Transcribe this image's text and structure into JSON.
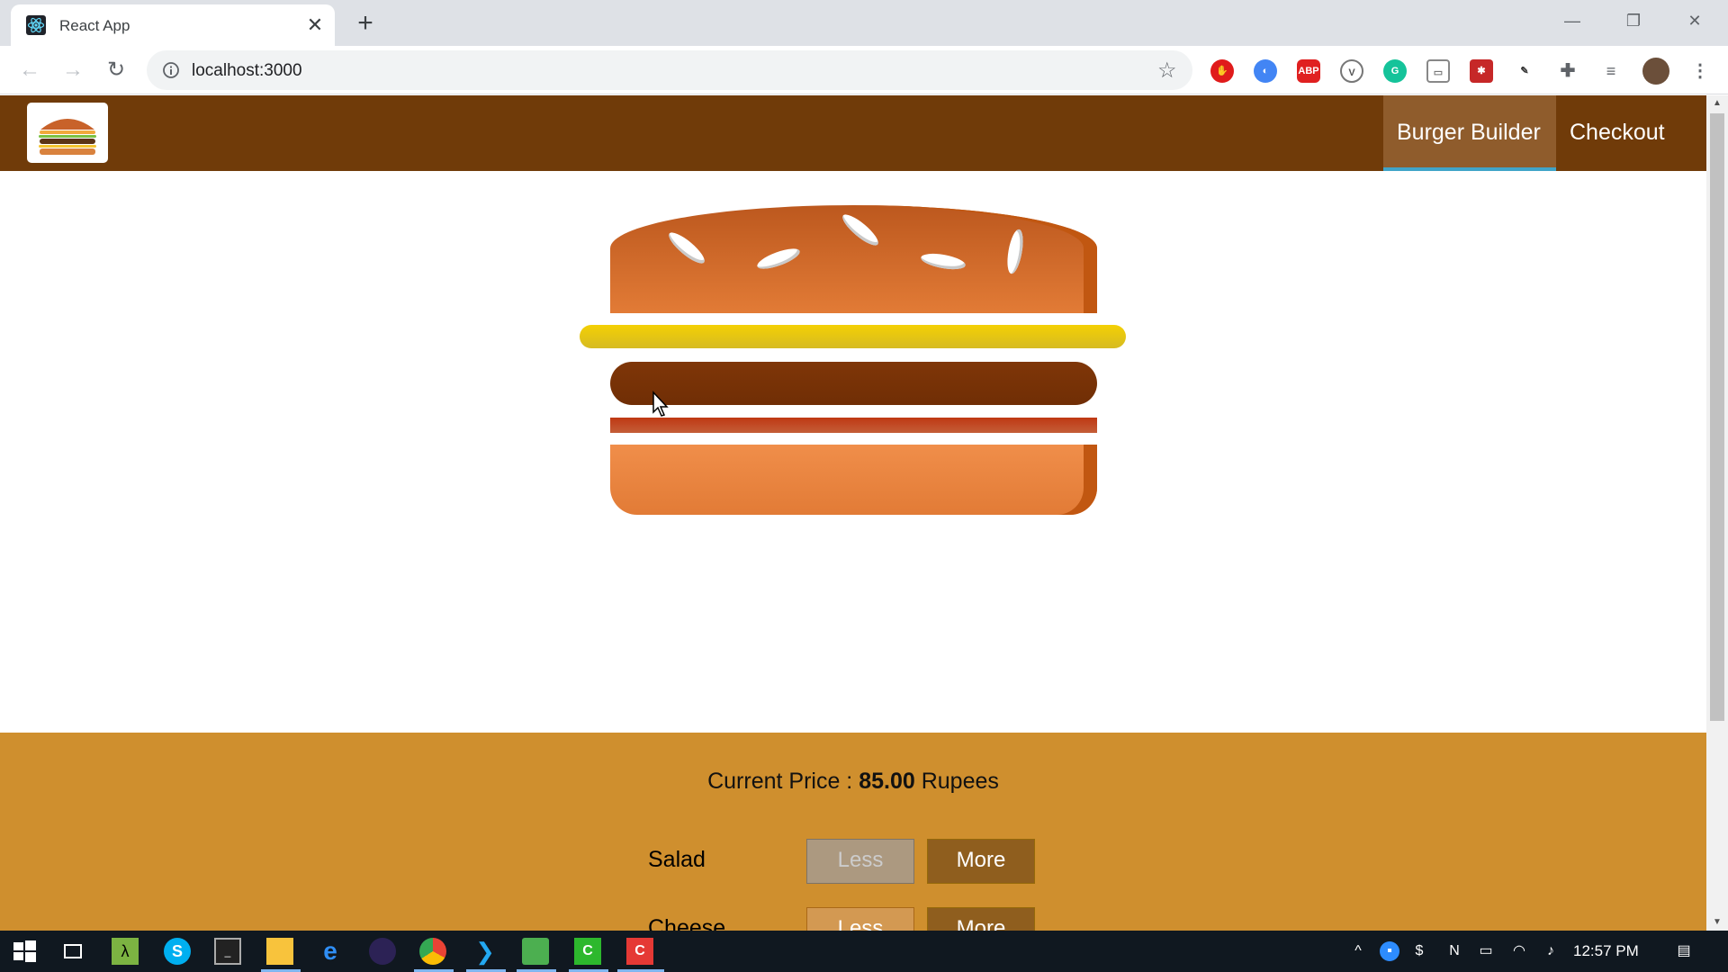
{
  "browser": {
    "tab_title": "React App",
    "url": "localhost:3000",
    "tab_close": "✕",
    "new_tab": "+"
  },
  "app": {
    "nav": {
      "burger_builder": "Burger Builder",
      "checkout": "Checkout"
    },
    "price_label": "Current Price : ",
    "price_value": "85.00",
    "price_unit": " Rupees",
    "controls": [
      {
        "label": "Salad",
        "less": "Less",
        "more": "More",
        "less_disabled": true
      },
      {
        "label": "Cheese",
        "less": "Less",
        "more": "More",
        "less_disabled": false
      }
    ]
  },
  "taskbar": {
    "clock": "12:57 PM"
  },
  "colors": {
    "header": "#703b09",
    "active_nav": "#8f5c2c",
    "controls_bg": "#cf8f2e"
  }
}
